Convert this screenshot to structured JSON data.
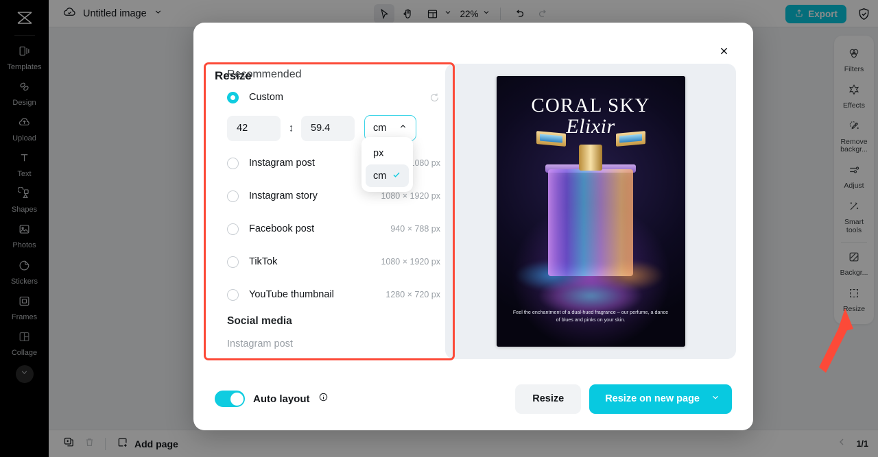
{
  "topbar": {
    "cloud_icon": "cloud-check-icon",
    "doc_name": "Untitled image",
    "doc_chevron": "chevron-down-icon",
    "tools": [
      {
        "name": "select-tool",
        "icon": "cursor-arrow-icon",
        "active": true
      },
      {
        "name": "hand-tool",
        "icon": "hand-icon",
        "active": false
      },
      {
        "name": "layout-tool",
        "icon": "layout-grid-icon",
        "active": false
      }
    ],
    "zoom_level": "22%",
    "undo_icon": "undo-arrow-icon",
    "redo_icon": "redo-arrow-icon",
    "export_label": "Export",
    "export_icon": "share-upload-icon",
    "shield_icon": "shield-check-icon"
  },
  "left_sidebar": {
    "logo_icon": "capcut-logo-icon",
    "items": [
      {
        "label": "Templates",
        "icon": "templates-icon"
      },
      {
        "label": "Design",
        "icon": "design-icon"
      },
      {
        "label": "Upload",
        "icon": "upload-cloud-icon"
      },
      {
        "label": "Text",
        "icon": "text-t-icon"
      },
      {
        "label": "Shapes",
        "icon": "shapes-icon"
      },
      {
        "label": "Photos",
        "icon": "photos-image-icon"
      },
      {
        "label": "Stickers",
        "icon": "stickers-icon"
      },
      {
        "label": "Frames",
        "icon": "frames-icon"
      },
      {
        "label": "Collage",
        "icon": "collage-icon"
      }
    ],
    "more_icon": "chevron-down-icon"
  },
  "right_sidebar": {
    "items": [
      {
        "label": "Filters",
        "icon": "filters-circles-icon"
      },
      {
        "label": "Effects",
        "icon": "effects-star-icon"
      },
      {
        "label": "Remove backgr...",
        "icon": "remove-background-icon"
      },
      {
        "label": "Adjust",
        "icon": "adjust-sliders-icon"
      },
      {
        "label": "Smart tools",
        "icon": "smart-tools-wand-icon"
      },
      {
        "label": "Backgr...",
        "icon": "background-icon"
      },
      {
        "label": "Resize",
        "icon": "resize-icon"
      }
    ]
  },
  "bottom_bar": {
    "duplicate_icon": "duplicate-page-icon",
    "delete_icon": "trash-icon",
    "add_page_label": "Add page",
    "add_page_icon": "plus-square-icon",
    "prev_icon": "chevron-left-icon",
    "page_count": "1/1"
  },
  "modal": {
    "title": "Resize",
    "close_icon": "close-x-icon",
    "sections": {
      "recommended_title": "Recommended",
      "social_title": "Social media"
    },
    "custom": {
      "label": "Custom",
      "selected": true,
      "reset_icon": "reset-arrow-icon",
      "width": "42",
      "height": "59.4",
      "link_icon": "link-ratio-icon",
      "unit": "cm",
      "unit_chevron": "chevron-up-icon"
    },
    "unit_menu": {
      "open": true,
      "options": [
        {
          "label": "px",
          "selected": false
        },
        {
          "label": "cm",
          "selected": true,
          "check_icon": "check-icon"
        }
      ]
    },
    "presets": [
      {
        "label": "Instagram post",
        "size": "1080 × 1080 px"
      },
      {
        "label": "Instagram story",
        "size": "1080 × 1920 px"
      },
      {
        "label": "Facebook post",
        "size": "940 × 788 px"
      },
      {
        "label": "TikTok",
        "size": "1080 × 1920 px"
      },
      {
        "label": "YouTube thumbnail",
        "size": "1280 × 720 px"
      }
    ],
    "social_presets": [
      {
        "label": "Instagram post",
        "size": ""
      }
    ],
    "preview": {
      "poster_title": "CORAL SKY",
      "poster_subtitle": "Elixir",
      "poster_tagline": "Feel the enchantment of a dual-hued fragrance – our perfume, a dance of blues and pinks on your skin."
    },
    "footer": {
      "auto_layout_label": "Auto layout",
      "info_icon": "info-circle-icon",
      "resize_label": "Resize",
      "resize_new_page_label": "Resize on new page",
      "primary_chevron": "chevron-down-icon"
    }
  },
  "annotation": {
    "arrow_icon": "red-arrow-icon",
    "arrow_color": "#fc4a38"
  },
  "colors": {
    "accent": "#08c9e0",
    "highlight": "#fc4a38",
    "panel_bg": "#eceff3"
  }
}
